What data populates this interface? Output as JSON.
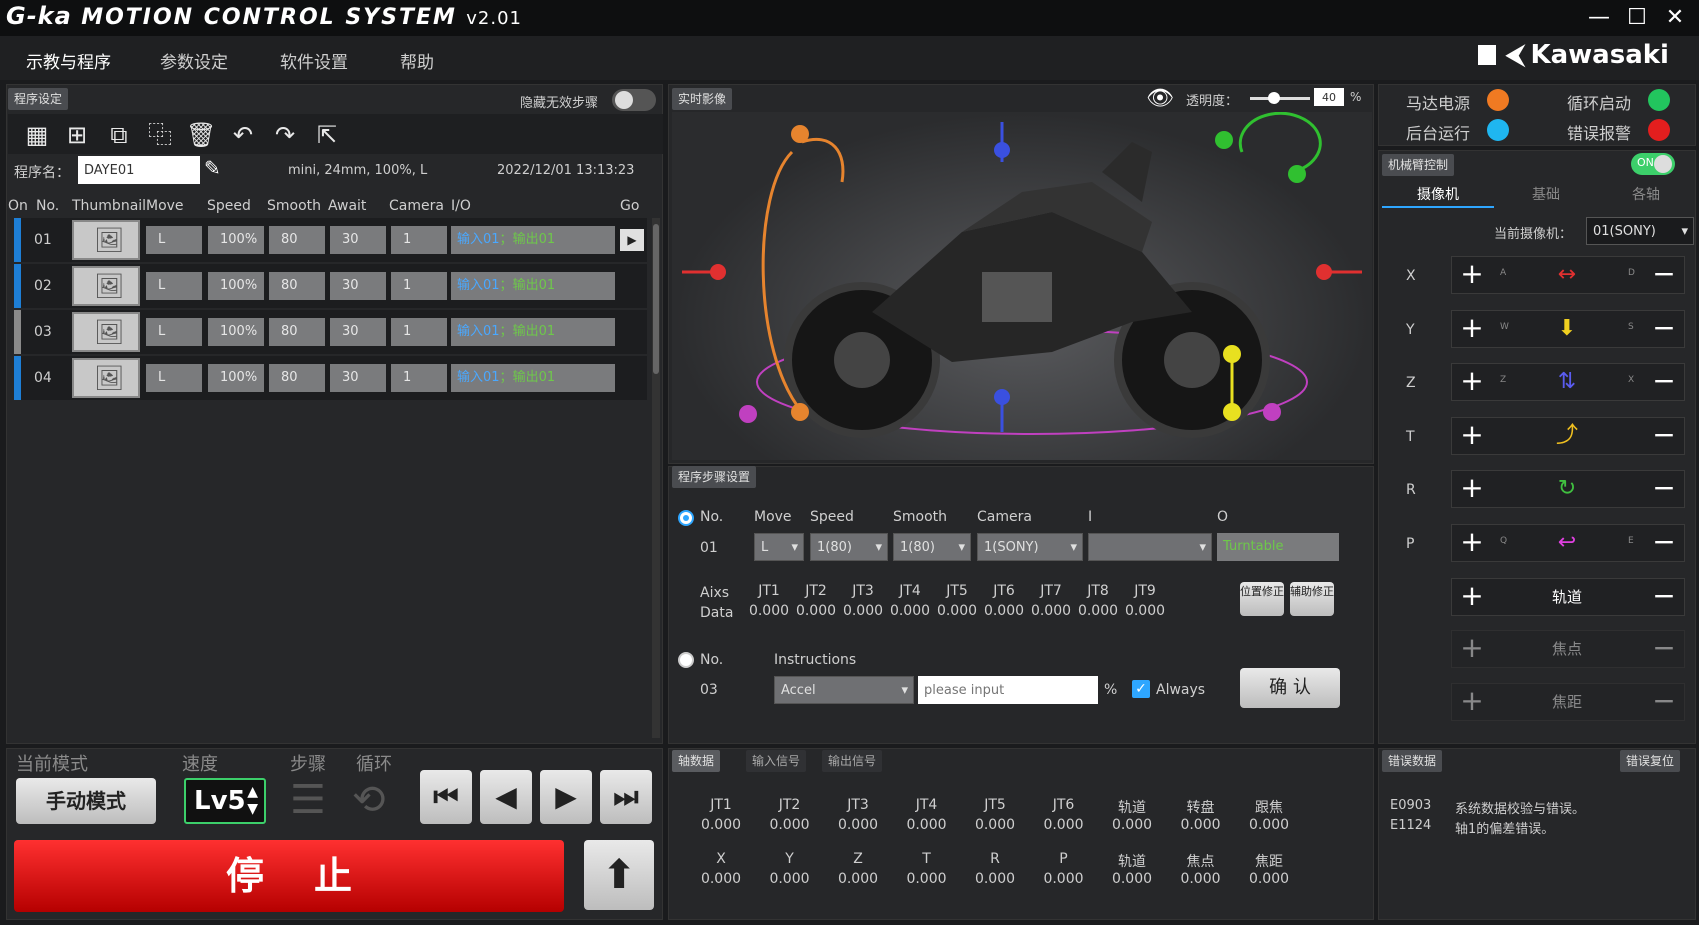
{
  "app": {
    "brand_g": "G-ka",
    "brand_name": "MOTION CONTROL SYSTEM",
    "version": "v2.01",
    "logo_text": "Kawasaki",
    "window_min": "—",
    "window_max": "☐",
    "window_close": "✕"
  },
  "menu": [
    "示教与程序",
    "参数设定",
    "软件设置",
    "帮助"
  ],
  "program_panel": {
    "tag": "程序设定",
    "hide_steps_label": "隐藏无效步骤",
    "program_name_label": "程序名：",
    "program_name_value": "DAYE01",
    "info": "mini, 24mm, 100%, L",
    "datetime": "2022/12/01   13:13:23",
    "columns": [
      "On",
      "No.",
      "Thumbnail",
      "Move",
      "Speed",
      "Smooth",
      "Await",
      "Camera",
      "I/O",
      "Go"
    ],
    "rows": [
      {
        "no": "01",
        "move": "L",
        "speed": "100%",
        "smooth": "80",
        "await": "30",
        "camera": "1",
        "io_in": "输入01",
        "io_out": "输出01",
        "bar": "#1e7fd6"
      },
      {
        "no": "02",
        "move": "L",
        "speed": "100%",
        "smooth": "80",
        "await": "30",
        "camera": "1",
        "io_in": "输入01",
        "io_out": "输出01",
        "bar": "#1e7fd6"
      },
      {
        "no": "03",
        "move": "L",
        "speed": "100%",
        "smooth": "80",
        "await": "30",
        "camera": "1",
        "io_in": "输入01",
        "io_out": "输出01",
        "bar": "#8a8a8a"
      },
      {
        "no": "04",
        "move": "L",
        "speed": "100%",
        "smooth": "80",
        "await": "30",
        "camera": "1",
        "io_in": "输入01",
        "io_out": "输出01",
        "bar": "#1e7fd6"
      }
    ]
  },
  "mode_panel": {
    "mode_label": "当前模式",
    "speed_label": "速度",
    "step_label": "步骤",
    "loop_label": "循环",
    "mode_button": "手动模式",
    "speed_value": "Lv5",
    "stop_button": "停止"
  },
  "live_panel": {
    "tag": "实时影像",
    "opacity_label": "透明度：",
    "opacity_value": "40",
    "opacity_unit": "%",
    "opacity_fraction": 0.4
  },
  "step_panel": {
    "tag": "程序步骤设置",
    "headers": [
      "No.",
      "Move",
      "Speed",
      "Smooth",
      "Camera",
      "I",
      "O"
    ],
    "no": "01",
    "move": "L",
    "speed": "1(80)",
    "smooth": "1(80)",
    "camera": "1(SONY)",
    "i_value": "",
    "o_value": "Turntable",
    "axis_labels": [
      "Aixs",
      "Data"
    ],
    "joints": [
      "JT1",
      "JT2",
      "JT3",
      "JT4",
      "JT5",
      "JT6",
      "JT7",
      "JT8",
      "JT9"
    ],
    "joint_values": [
      "0.000",
      "0.000",
      "0.000",
      "0.000",
      "0.000",
      "0.000",
      "0.000",
      "0.000",
      "0.000"
    ],
    "btn_pos": "位置修正",
    "btn_aux": "辅助修正",
    "instr_no_label": "No.",
    "instr_label": "Instructions",
    "instr_no": "03",
    "instr_value": "Accel",
    "instr_placeholder": "please input",
    "instr_unit": "%",
    "always_label": "Always",
    "confirm_button": "确 认"
  },
  "axis_data_panel": {
    "tabs": [
      "轴数据",
      "输入信号",
      "输出信号"
    ],
    "row1_labels": [
      "JT1",
      "JT2",
      "JT3",
      "JT4",
      "JT5",
      "JT6",
      "轨道",
      "转盘",
      "跟焦"
    ],
    "row1_values": [
      "0.000",
      "0.000",
      "0.000",
      "0.000",
      "0.000",
      "0.000",
      "0.000",
      "0.000",
      "0.000"
    ],
    "row2_labels": [
      "X",
      "Y",
      "Z",
      "T",
      "R",
      "P",
      "轨道",
      "焦点",
      "焦距"
    ],
    "row2_values": [
      "0.000",
      "0.000",
      "0.000",
      "0.000",
      "0.000",
      "0.000",
      "0.000",
      "0.000",
      "0.000"
    ]
  },
  "status": {
    "motor_power": "马达电源",
    "cycle_start": "循环启动",
    "background_run": "后台运行",
    "error_alarm": "错误报警",
    "colors": {
      "motor": "#f07a22",
      "cycle": "#22c55e",
      "background": "#1fb6f0",
      "error": "#e31e1e"
    }
  },
  "arm_panel": {
    "tag": "机械臂控制",
    "toggle": "ON",
    "tabs": [
      "摄像机",
      "基础",
      "各轴"
    ],
    "current_camera_label": "当前摄像机：",
    "current_camera_value": "01(SONY)",
    "axes": [
      {
        "name": "X",
        "left_key": "A",
        "right_key": "D",
        "icon": "↔",
        "color": "#e03030"
      },
      {
        "name": "Y",
        "left_key": "W",
        "right_key": "S",
        "icon": "⬇",
        "color": "#f0d020"
      },
      {
        "name": "Z",
        "left_key": "Z",
        "right_key": "X",
        "icon": "⇅",
        "color": "#5a5cf0"
      },
      {
        "name": "T",
        "left_key": "",
        "right_key": "",
        "icon": "⤴",
        "color": "#f0c020"
      },
      {
        "name": "R",
        "left_key": "",
        "right_key": "",
        "icon": "↻",
        "color": "#40c040"
      },
      {
        "name": "P",
        "left_key": "Q",
        "right_key": "E",
        "icon": "↩",
        "color": "#e040e0"
      }
    ],
    "track_label": "轨道",
    "focus_label": "焦点",
    "focal_label": "焦距"
  },
  "error_panel": {
    "tag": "错误数据",
    "reset_button": "错误复位",
    "errors": [
      {
        "code": "E0903",
        "msg": "系统数据校验与错误。"
      },
      {
        "code": "E1124",
        "msg": "轴1的偏差错误。"
      }
    ]
  }
}
